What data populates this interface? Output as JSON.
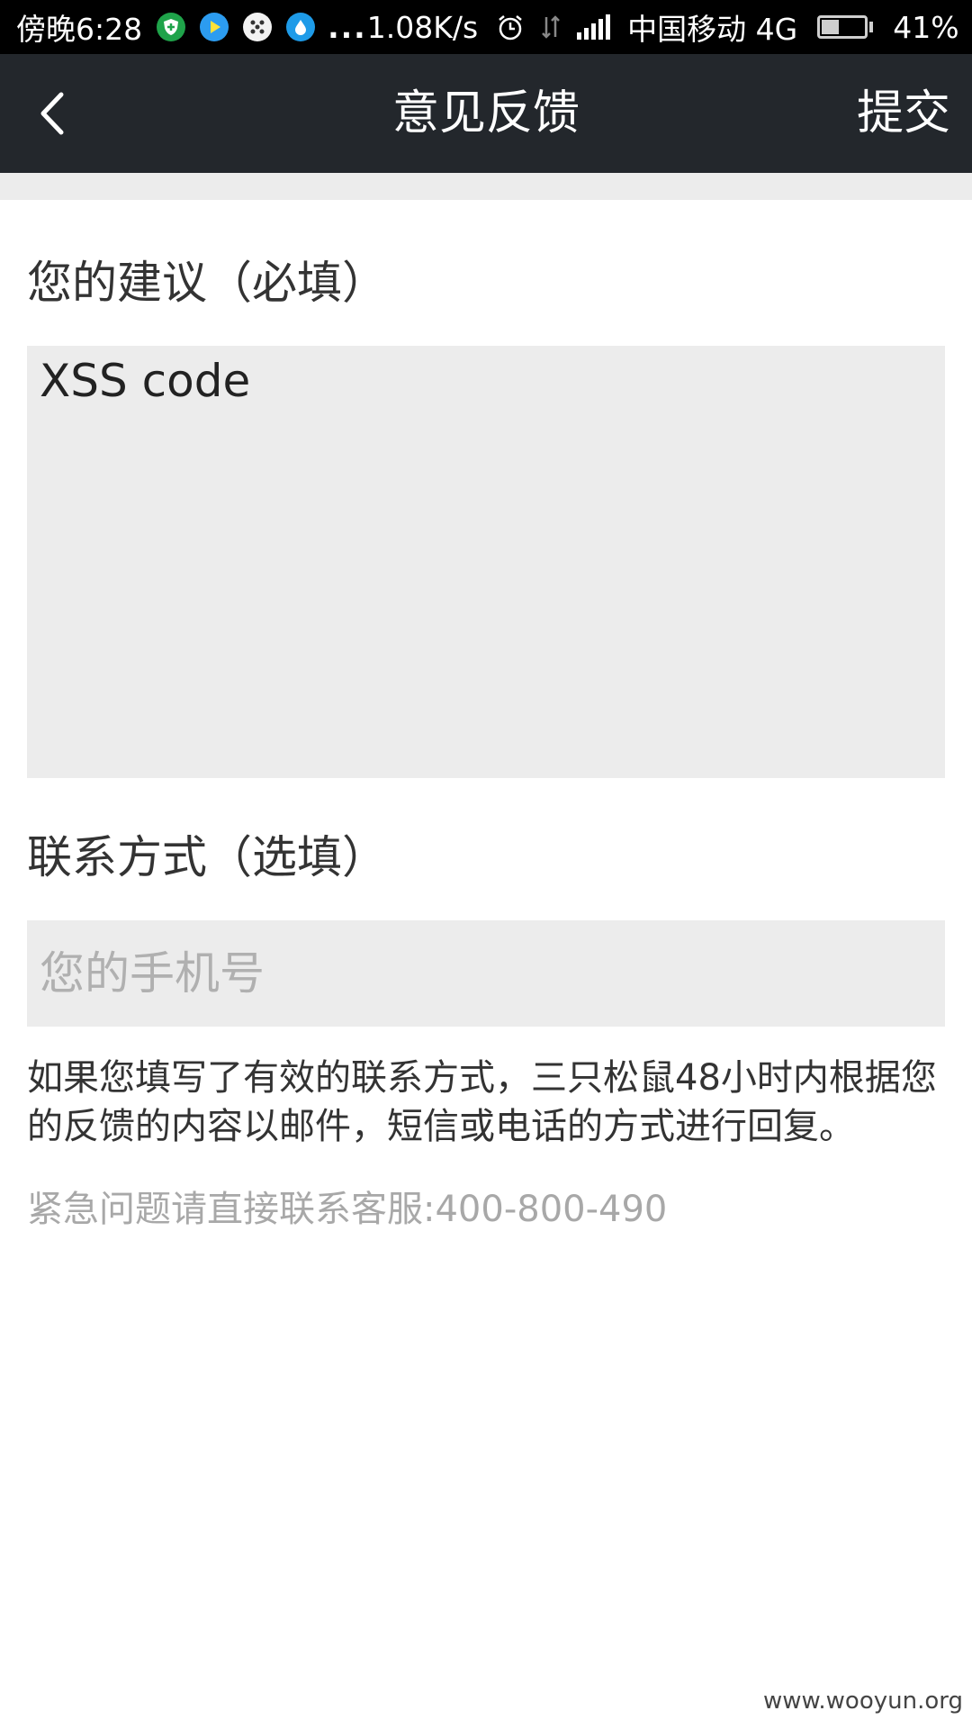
{
  "status_bar": {
    "time": "傍晚6:28",
    "more": "...",
    "net_speed": "1.08K/s",
    "carrier": "中国移动 4G",
    "battery": "41%",
    "battery_level": 0.41,
    "icons": [
      "shield-icon",
      "play-icon",
      "dice-icon",
      "water-drop-icon",
      "alarm-icon",
      "data-arrows-icon",
      "signal-icon",
      "battery-icon"
    ]
  },
  "nav": {
    "title": "意见反馈",
    "submit": "提交",
    "back_icon": "chevron-left-icon"
  },
  "form": {
    "suggestion_label": "您的建议（必填）",
    "suggestion_value": "XSS code",
    "contact_label": "联系方式（选填）",
    "phone_placeholder": "您的手机号"
  },
  "info": {
    "note": "如果您填写了有效的联系方式，三只松鼠48小时内根据您的反馈的内容以邮件，短信或电话的方式进行回复。",
    "urgent": "紧急问题请直接联系客服:400-800-490"
  },
  "watermark": "www.wooyun.org",
  "colors": {
    "nav_bg": "#23272c",
    "field_bg": "#ececec",
    "status_bg": "#000000"
  }
}
